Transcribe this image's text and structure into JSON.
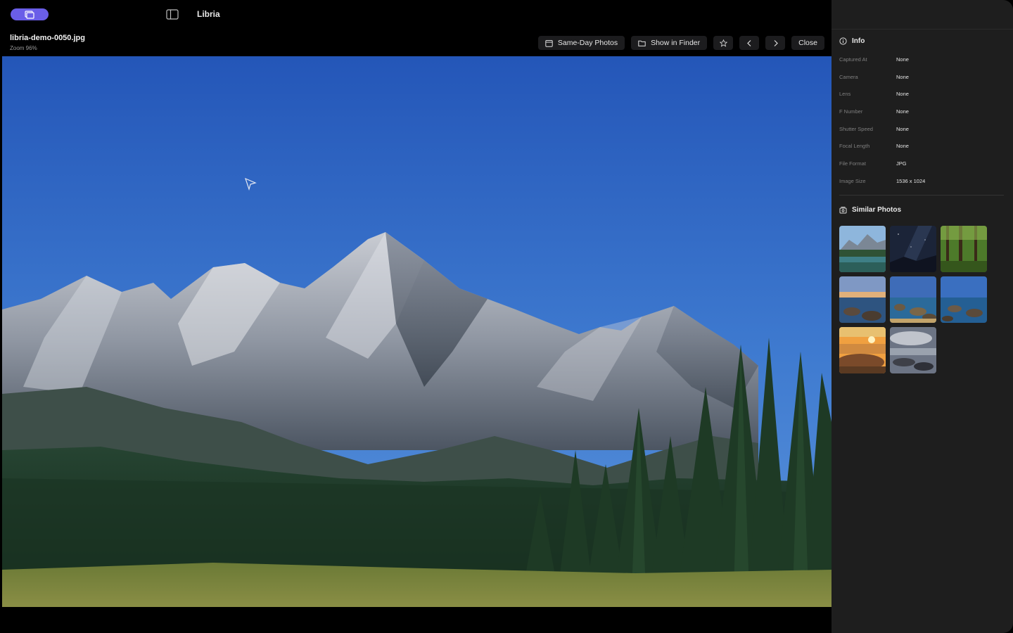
{
  "app": {
    "title": "Libria"
  },
  "viewer": {
    "file_name": "libria-demo-0050.jpg",
    "zoom_label": "Zoom 96%"
  },
  "toolbar": {
    "same_day_label": "Same-Day Photos",
    "show_in_finder_label": "Show in Finder",
    "close_label": "Close"
  },
  "info": {
    "title": "Info",
    "rows": [
      {
        "key": "Captured At",
        "value": "None"
      },
      {
        "key": "Camera",
        "value": "None"
      },
      {
        "key": "Lens",
        "value": "None"
      },
      {
        "key": "F Number",
        "value": "None"
      },
      {
        "key": "Shutter Speed",
        "value": "None"
      },
      {
        "key": "Focal Length",
        "value": "None"
      },
      {
        "key": "File Format",
        "value": "JPG"
      },
      {
        "key": "Image Size",
        "value": "1536 x 1024"
      }
    ]
  },
  "similar": {
    "title": "Similar Photos",
    "thumbnails": [
      {
        "icon": "mountain-lake"
      },
      {
        "icon": "night-sky"
      },
      {
        "icon": "forest-path"
      },
      {
        "icon": "rocky-coast"
      },
      {
        "icon": "rocky-coast"
      },
      {
        "icon": "rocky-coast"
      },
      {
        "icon": "sunset-coast"
      },
      {
        "icon": "cloudy-coast"
      }
    ]
  },
  "colors": {
    "accent": "#6a5ee8",
    "inspector_bg": "#1e1e1e",
    "sky_top": "#2456b8",
    "sky_bottom": "#4d87d6"
  }
}
